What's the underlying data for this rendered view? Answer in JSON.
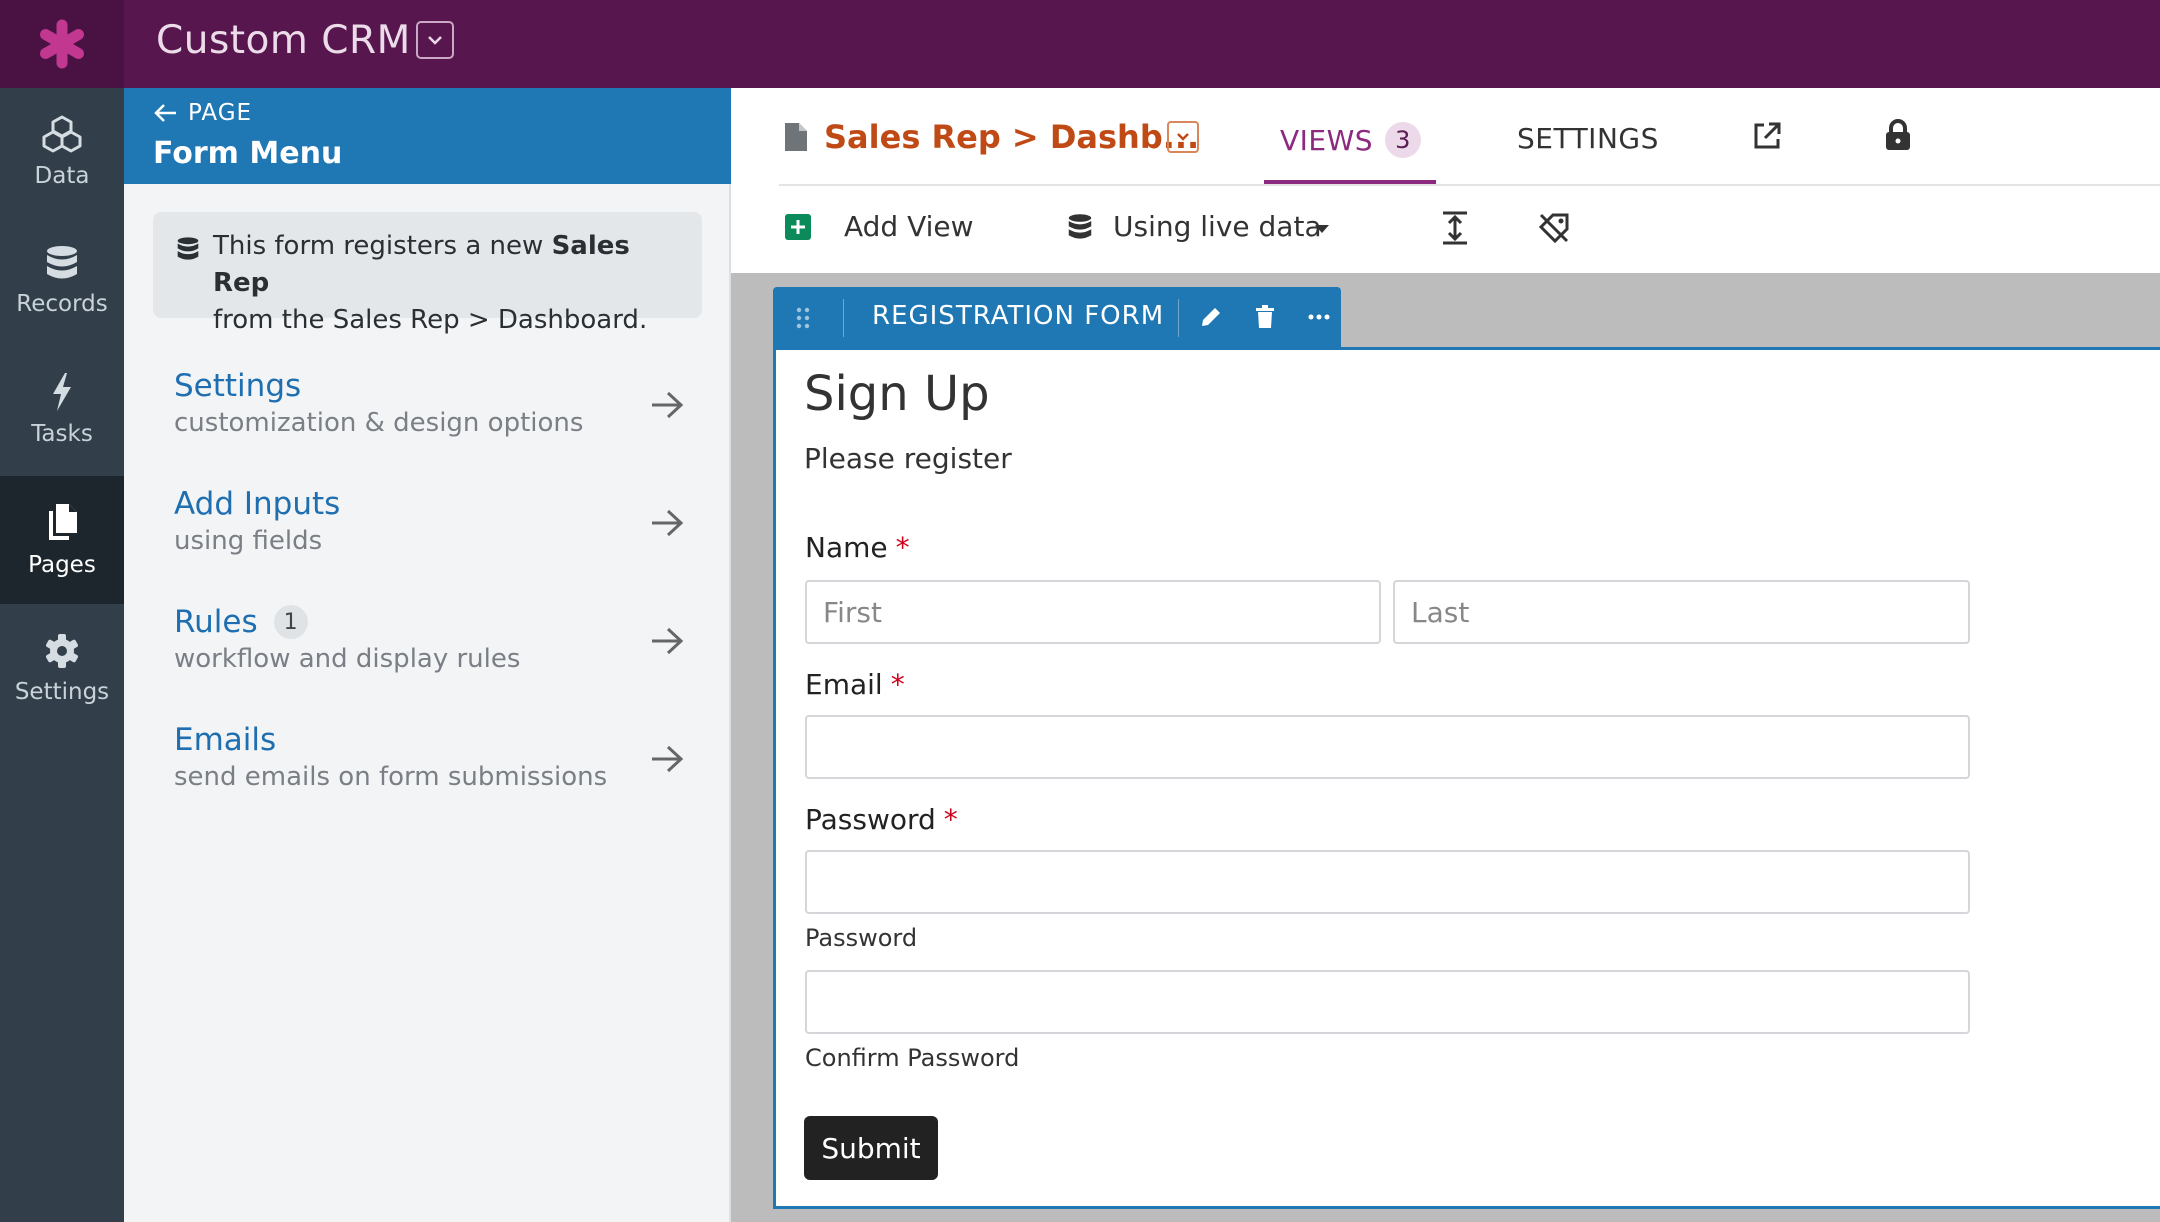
{
  "app": {
    "title": "Custom CRM"
  },
  "colors": {
    "topbar": "#57164d",
    "accent_blue": "#1f78b4",
    "crumb_orange": "#c04a16",
    "views_purple": "#8b2a7e",
    "required_red": "#d0021b"
  },
  "nav": {
    "items": [
      {
        "label": "Data",
        "icon": "cubes-icon"
      },
      {
        "label": "Records",
        "icon": "database-icon"
      },
      {
        "label": "Tasks",
        "icon": "bolt-icon"
      },
      {
        "label": "Pages",
        "icon": "pages-icon",
        "active": true
      },
      {
        "label": "Settings",
        "icon": "gear-icon"
      }
    ]
  },
  "panel": {
    "back_label": "PAGE",
    "title": "Form Menu",
    "info": {
      "prefix": "This form registers a new ",
      "bold": "Sales Rep",
      "suffix": "from the Sales Rep > Dashboard."
    },
    "menu": [
      {
        "title": "Settings",
        "subtitle": "customization & design options"
      },
      {
        "title": "Add Inputs",
        "subtitle": "using fields"
      },
      {
        "title": "Rules",
        "badge": "1",
        "subtitle": "workflow and display rules"
      },
      {
        "title": "Emails",
        "subtitle": "send emails on form submissions"
      }
    ]
  },
  "header": {
    "crumb": "Sales Rep > Dashb...",
    "tabs": {
      "views_label": "VIEWS",
      "views_count": "3",
      "settings_label": "SETTINGS"
    }
  },
  "toolbar": {
    "add_view": "Add View",
    "data_source": "Using live data"
  },
  "view": {
    "type_label": "REGISTRATION FORM",
    "form": {
      "title": "Sign Up",
      "description": "Please register",
      "name_label": "Name",
      "first_placeholder": "First",
      "last_placeholder": "Last",
      "email_label": "Email",
      "password_label": "Password",
      "password_help": "Password",
      "confirm_help": "Confirm Password",
      "required_mark": "*",
      "submit_label": "Submit"
    }
  }
}
